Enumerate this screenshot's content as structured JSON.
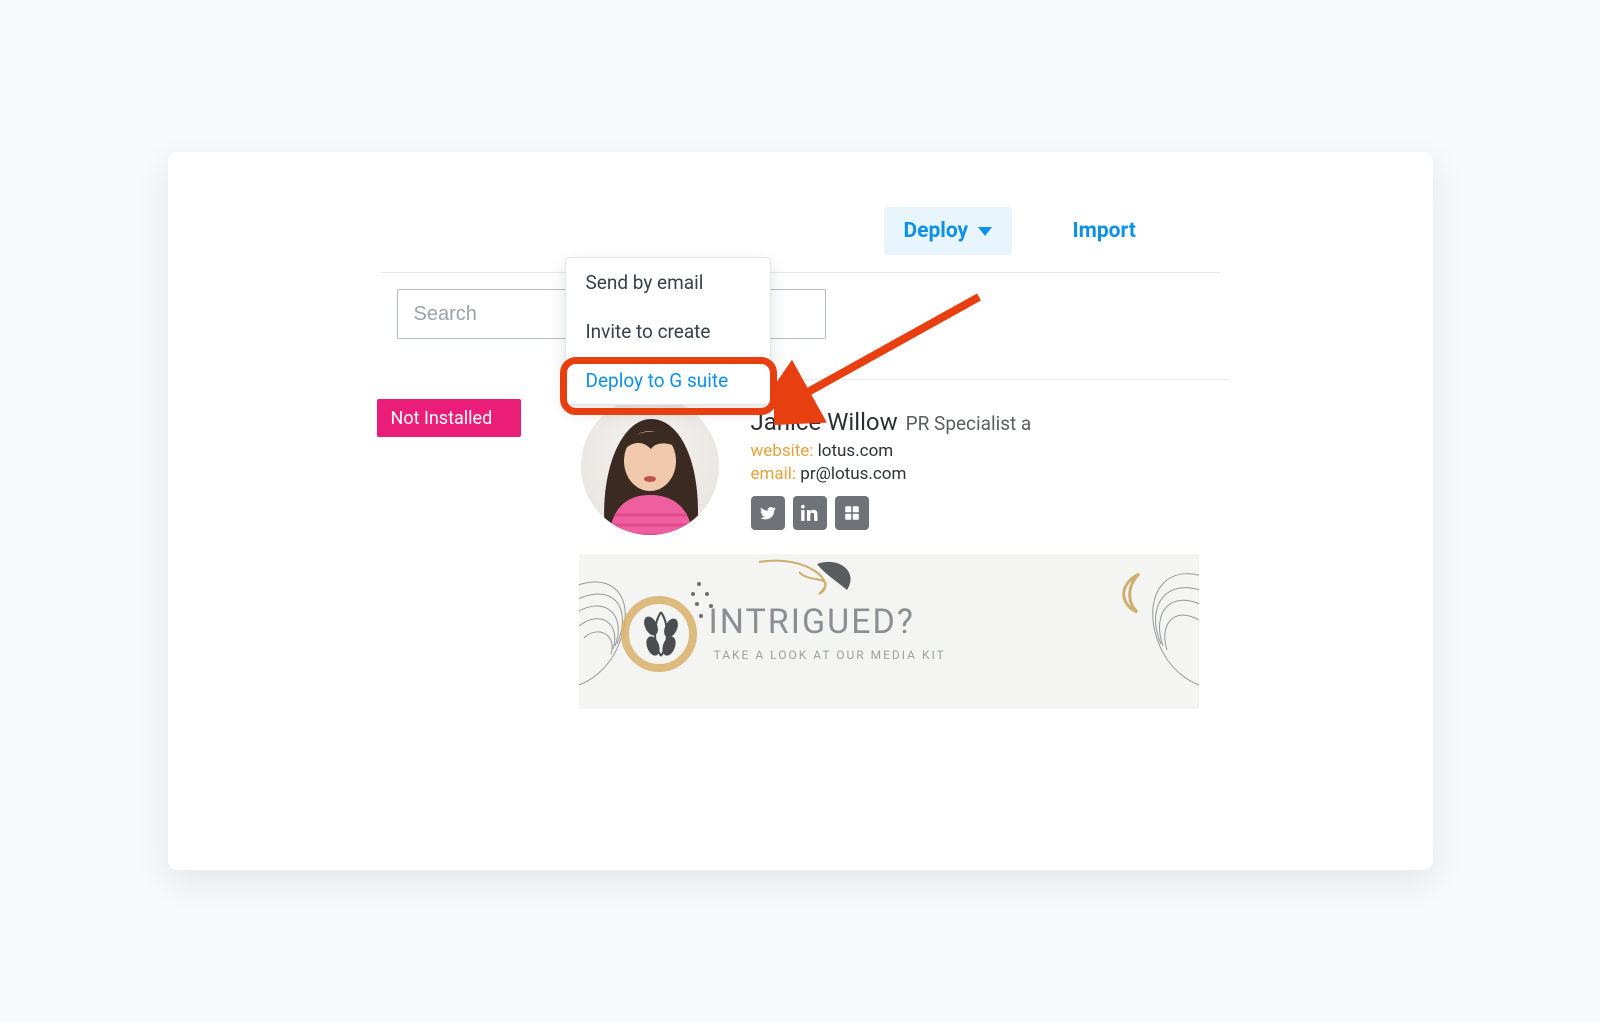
{
  "actions": {
    "deploy_label": "Deploy",
    "import_label": "Import"
  },
  "search": {
    "placeholder": "Search"
  },
  "menu": {
    "items": [
      "Send by email",
      "Invite to create",
      "Deploy to G suite"
    ]
  },
  "status": {
    "not_installed": "Not Installed"
  },
  "signature": {
    "name": "Janice Willow",
    "role": "PR Specialist a",
    "website_label": "website:",
    "website_value": "lotus.com",
    "email_label": "email:",
    "email_value": "pr@lotus.com",
    "banner_headline": "INTRIGUED?",
    "banner_sub": "TAKE A LOOK AT OUR MEDIA KIT"
  },
  "colors": {
    "accent_blue": "#0c91e6",
    "accent_bg": "#e9f5fd",
    "highlight_red": "#e83f11",
    "magenta": "#ea1e78",
    "mustard": "#e7a13c"
  }
}
